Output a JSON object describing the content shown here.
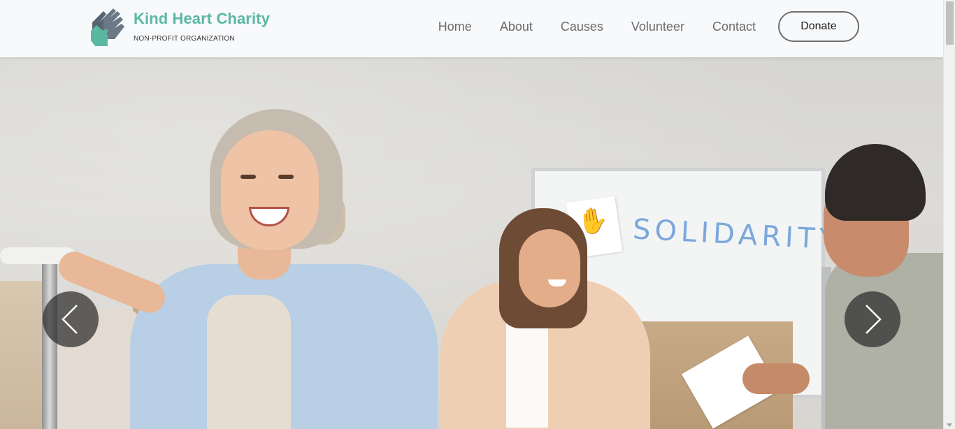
{
  "brand": {
    "name": "Kind Heart Charity",
    "tagline": "NON-PROFIT ORGANIZATION",
    "logo_icon": "hands-heart-icon",
    "primary_color": "#5ab8a2",
    "secondary_color": "#566471"
  },
  "nav": {
    "items": [
      {
        "label": "Home"
      },
      {
        "label": "About"
      },
      {
        "label": "Causes"
      },
      {
        "label": "Volunteer"
      },
      {
        "label": "Contact"
      }
    ],
    "donate_label": "Donate"
  },
  "hero": {
    "whiteboard_text": "SOLIDARITY",
    "prev_icon": "chevron-left-icon",
    "next_icon": "chevron-right-icon"
  }
}
